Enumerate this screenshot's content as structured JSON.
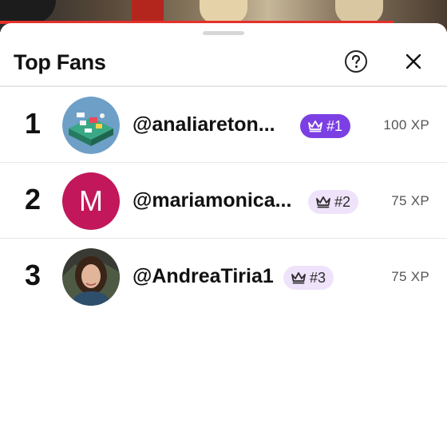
{
  "sheet": {
    "title": "Top Fans"
  },
  "icons": {
    "help": "question-circle-icon",
    "close": "close-x-icon",
    "badge": "crown-icon"
  },
  "colors": {
    "accent_purple": "#7b3fe4",
    "badge_soft": "#efe3fb",
    "avatar_m": "#c2185b",
    "progress_red": "#e5302b"
  },
  "fans": [
    {
      "rank": "1",
      "handle": "@analiareton...",
      "badge": "#1",
      "xp": "100 XP"
    },
    {
      "rank": "2",
      "handle": "@mariamonica...",
      "avatar_letter": "M",
      "badge": "#2",
      "xp": "75 XP"
    },
    {
      "rank": "3",
      "handle": "@AndreaTiria1",
      "badge": "#3",
      "xp": "75 XP"
    }
  ]
}
